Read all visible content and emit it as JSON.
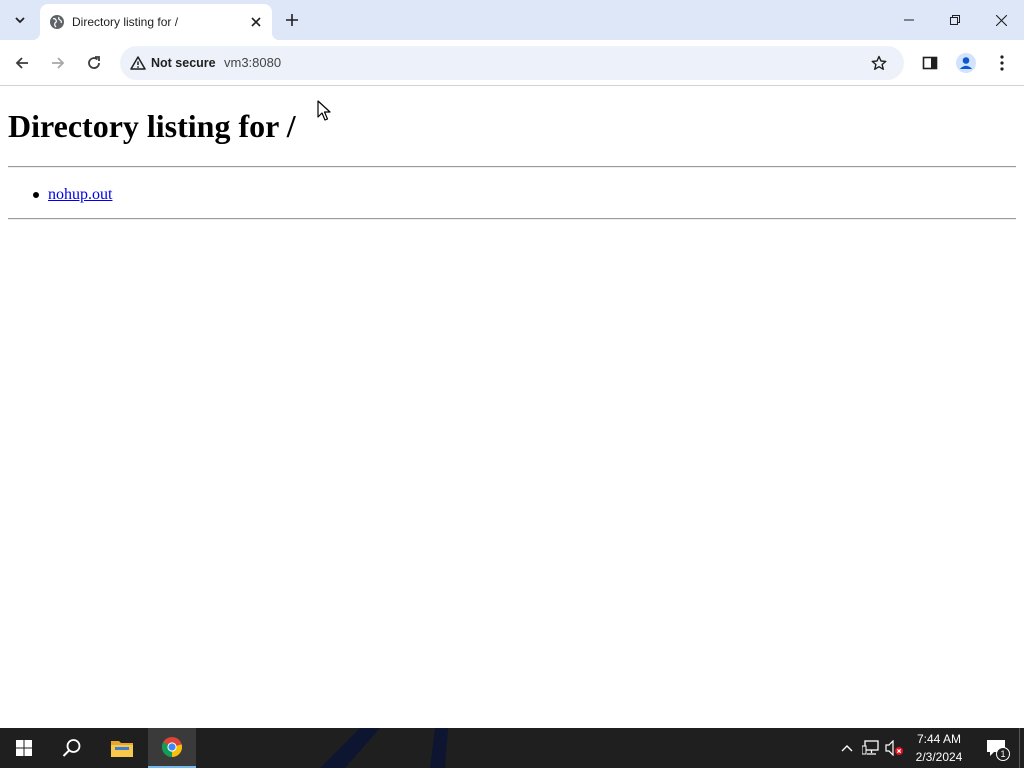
{
  "browser": {
    "tab": {
      "title": "Directory listing for /",
      "icon": "globe-icon"
    },
    "security_chip": {
      "label": "Not secure",
      "icon": "warning-triangle-icon"
    },
    "url": "vm3:8080",
    "window_controls": [
      "minimize",
      "restore",
      "close"
    ]
  },
  "page": {
    "heading": "Directory listing for /",
    "files": [
      {
        "name": "nohup.out"
      }
    ]
  },
  "taskbar": {
    "pinned": [
      "windows-start",
      "search",
      "file-explorer",
      "chrome"
    ],
    "active": "chrome",
    "clock": {
      "time": "7:44 AM",
      "date": "2/3/2024"
    },
    "notification_count": "1"
  },
  "colors": {
    "tabstrip": "#dde7f8",
    "omnibox": "#edf2fa",
    "link": "#0000ee",
    "taskbar": "#1f1f1f"
  }
}
